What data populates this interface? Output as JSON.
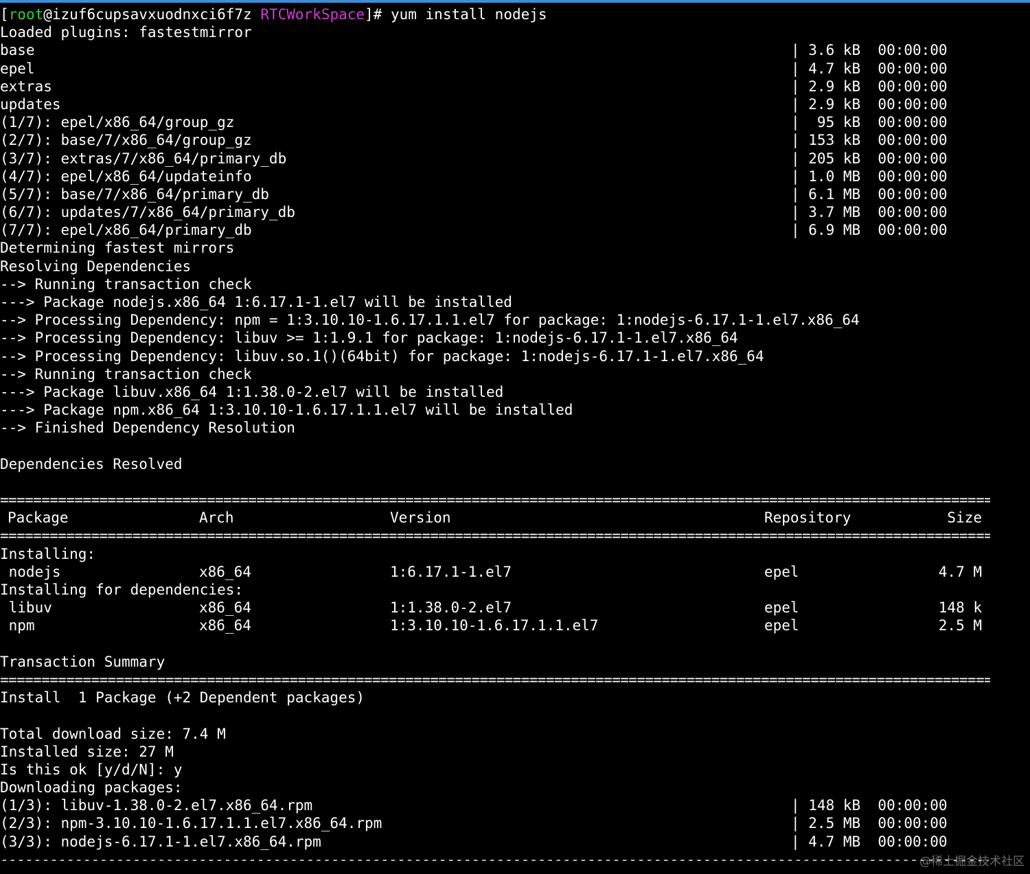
{
  "prompt": {
    "open": "[",
    "user": "root",
    "host": "@izuf6cupsavxuodnxci6f7z ",
    "dir": "RTCWorkSpace",
    "close": "]# ",
    "command": "yum install nodejs"
  },
  "colors": {
    "background": "#000000",
    "text": "#ffffff",
    "user": "#2fd12f",
    "dir": "#d23ad2"
  },
  "plugins_line": "Loaded plugins: fastestmirror",
  "repo_downloads": [
    {
      "name": "base",
      "size": "| 3.6 kB  00:00:00"
    },
    {
      "name": "epel",
      "size": "| 4.7 kB  00:00:00"
    },
    {
      "name": "extras",
      "size": "| 2.9 kB  00:00:00"
    },
    {
      "name": "updates",
      "size": "| 2.9 kB  00:00:00"
    },
    {
      "name": "(1/7): epel/x86_64/group_gz",
      "size": "|  95 kB  00:00:00"
    },
    {
      "name": "(2/7): base/7/x86_64/group_gz",
      "size": "| 153 kB  00:00:00"
    },
    {
      "name": "(3/7): extras/7/x86_64/primary_db",
      "size": "| 205 kB  00:00:00"
    },
    {
      "name": "(4/7): epel/x86_64/updateinfo",
      "size": "| 1.0 MB  00:00:00"
    },
    {
      "name": "(5/7): base/7/x86_64/primary_db",
      "size": "| 6.1 MB  00:00:00"
    },
    {
      "name": "(6/7): updates/7/x86_64/primary_db",
      "size": "| 3.7 MB  00:00:00"
    },
    {
      "name": "(7/7): epel/x86_64/primary_db",
      "size": "| 6.9 MB  00:00:00"
    }
  ],
  "resolution_lines": [
    "Determining fastest mirrors",
    "Resolving Dependencies",
    "--> Running transaction check",
    "---> Package nodejs.x86_64 1:6.17.1-1.el7 will be installed",
    "--> Processing Dependency: npm = 1:3.10.10-1.6.17.1.1.el7 for package: 1:nodejs-6.17.1-1.el7.x86_64",
    "--> Processing Dependency: libuv >= 1:1.9.1 for package: 1:nodejs-6.17.1-1.el7.x86_64",
    "--> Processing Dependency: libuv.so.1()(64bit) for package: 1:nodejs-6.17.1-1.el7.x86_64",
    "--> Running transaction check",
    "---> Package libuv.x86_64 1:1.38.0-2.el7 will be installed",
    "---> Package npm.x86_64 1:3.10.10-1.6.17.1.1.el7 will be installed",
    "--> Finished Dependency Resolution"
  ],
  "resolved_line": "Dependencies Resolved",
  "separator": "==================================================================================================================================================================================================================",
  "table": {
    "headers": {
      "package": "Package",
      "arch": "Arch",
      "version": "Version",
      "repository": "Repository",
      "size": "Size"
    },
    "installing_label": "Installing:",
    "installing": [
      {
        "package": " nodejs",
        "arch": "x86_64",
        "version": "1:6.17.1-1.el7",
        "repository": "epel",
        "size": "4.7 M"
      }
    ],
    "deps_label": "Installing for dependencies:",
    "deps": [
      {
        "package": " libuv",
        "arch": "x86_64",
        "version": "1:1.38.0-2.el7",
        "repository": "epel",
        "size": "148 k"
      },
      {
        "package": " npm",
        "arch": "x86_64",
        "version": "1:3.10.10-1.6.17.1.1.el7",
        "repository": "epel",
        "size": "2.5 M"
      }
    ]
  },
  "summary": {
    "title": "Transaction Summary",
    "install_line": "Install  1 Package (+2 Dependent packages)",
    "total_download": "Total download size: 7.4 M",
    "installed_size": "Installed size: 27 M",
    "confirm": "Is this ok [y/d/N]: y",
    "downloading": "Downloading packages:"
  },
  "package_downloads": [
    {
      "name": "(1/3): libuv-1.38.0-2.el7.x86_64.rpm",
      "size": "| 148 kB  00:00:00"
    },
    {
      "name": "(2/3): npm-3.10.10-1.6.17.1.1.el7.x86_64.rpm",
      "size": "| 2.5 MB  00:00:00"
    },
    {
      "name": "(3/3): nodejs-6.17.1-1.el7.x86_64.rpm",
      "size": "| 4.7 MB  00:00:00"
    }
  ],
  "dash_separator": "--------------------------------------------------------------------------------------------------------------------------------------------------------------------------------------------------------------",
  "watermark": "@稀土掘金技术社区"
}
